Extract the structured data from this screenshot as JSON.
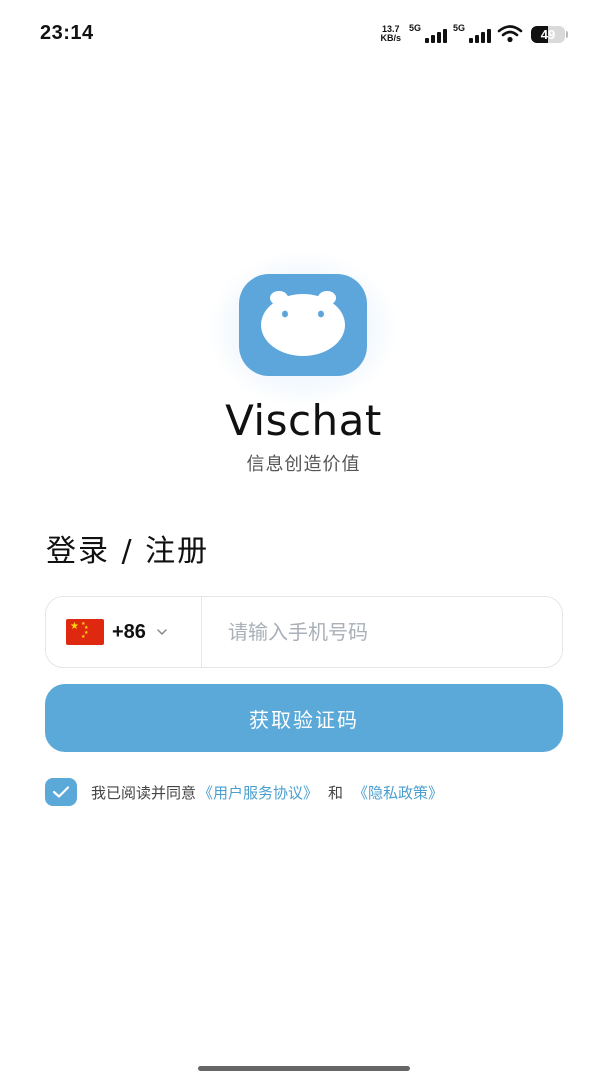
{
  "status_bar": {
    "time": "23:14",
    "net_speed_value": "13.7",
    "net_speed_unit": "KB/s",
    "signal1_label": "5G",
    "signal2_label": "5G",
    "battery": "49",
    "battery_level": 0.49
  },
  "app": {
    "name": "Vischat",
    "slogan": "信息创造价值",
    "brand_color": "#5da6dc"
  },
  "login": {
    "title": "登录 / 注册",
    "country_code": "+86",
    "phone_placeholder": "请输入手机号码",
    "phone_value": "",
    "get_code_label": "获取验证码",
    "agreement": {
      "checked": true,
      "prefix": "我已阅读并同意",
      "terms_link": "《用户服务协议》",
      "conjunction": "和",
      "privacy_link": "《隐私政策》"
    }
  }
}
